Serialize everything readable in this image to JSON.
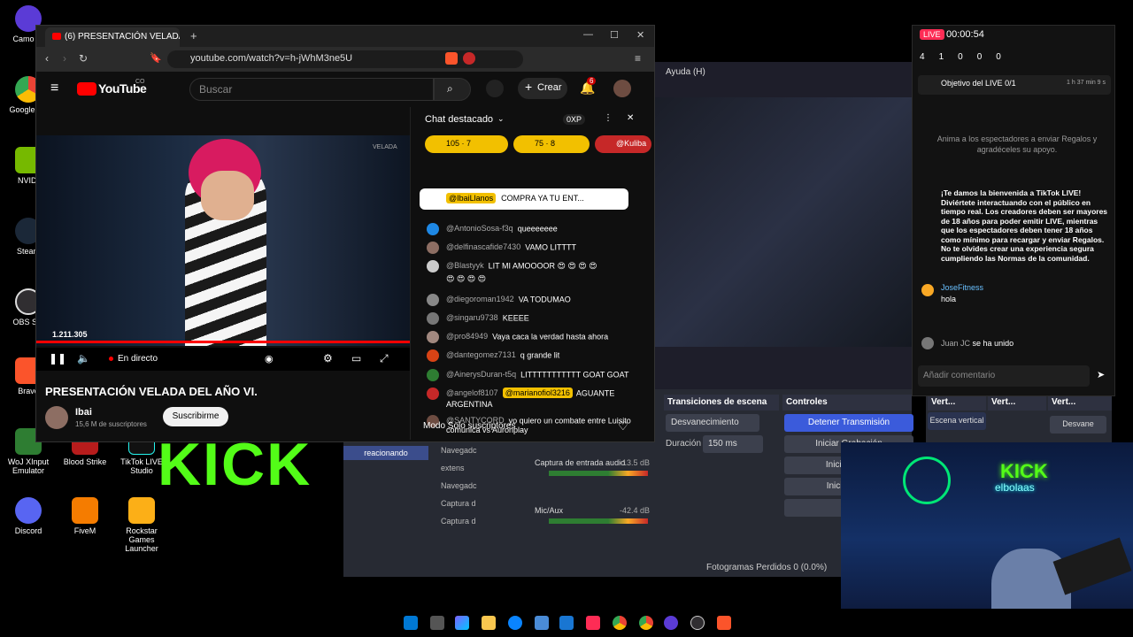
{
  "desktop": {
    "icons": [
      {
        "label": "Camo St",
        "color": "#5b3bd6"
      },
      {
        "label": "Google Ch",
        "color": "#2a8c3e"
      },
      {
        "label": "NVIDI",
        "color": "#76b900"
      },
      {
        "label": "Steam",
        "color": "#1b2838"
      },
      {
        "label": "OBS Stu",
        "color": "#302e31"
      },
      {
        "label": "Brave",
        "color": "#fb542b"
      },
      {
        "label": "WoJ XInput Emulator",
        "color": "#2e7d32"
      },
      {
        "label": "Blood Strike",
        "color": "#b71c1c"
      },
      {
        "label": "TikTok LIVE Studio",
        "color": "#111111"
      },
      {
        "label": "Discord",
        "color": "#5865f2"
      },
      {
        "label": "FiveM",
        "color": "#f57c00"
      },
      {
        "label": "Rockstar Games Launcher",
        "color": "#fcaf17"
      }
    ],
    "green_text": "KICK"
  },
  "browser": {
    "tab_title": "(6) PRESENTACIÓN VELADA D",
    "url": "youtube.com/watch?v=h-jWhM3ne5U",
    "window_controls": [
      "—",
      "☐",
      "✕"
    ]
  },
  "youtube": {
    "logo": "YouTube",
    "region": "CO",
    "search_placeholder": "Buscar",
    "create_label": "Crear",
    "notif_count": "6",
    "view_count": "1.211.305",
    "live_label": "En directo",
    "video_title": "PRESENTACIÓN VELADA DEL AÑO VI.",
    "channel_name": "Ibai",
    "subscribers": "15,6 M de suscriptores",
    "subscribe_label": "Suscribirme",
    "video_watermark": "VELADA"
  },
  "chat": {
    "title": "Chat destacado",
    "xp": "0XP",
    "pills": [
      {
        "likes": "105",
        "comments": "7"
      },
      {
        "likes": "75",
        "comments": "8"
      },
      {
        "name": "@Kuliba"
      }
    ],
    "pinned_author": "@IbaiLlanos",
    "pinned_text": "COMPRA YA TU ENT...",
    "messages": [
      {
        "author": "@AntonioSosa-f3q",
        "text": "queeeeeee",
        "color": "#1e88e5"
      },
      {
        "author": "@delfinascafide7430",
        "text": "VAMO LITTTT",
        "color": "#8d6e63"
      },
      {
        "author": "@Blastyyk",
        "text": "LIT MI AMOOOOR 😍 😍 😍 😍",
        "color": "#ccc"
      },
      {
        "author": "",
        "text": "😍 😍 😍 😍",
        "color": "transparent"
      },
      {
        "author": "@diegoroman1942",
        "text": "VA TODUMAO",
        "color": "#888"
      },
      {
        "author": "@singaru9738",
        "text": "KEEEE",
        "color": "#777"
      },
      {
        "author": "@pro84949",
        "text": "Vaya caca la verdad hasta ahora",
        "color": "#a1887f"
      },
      {
        "author": "@dantegomez7131",
        "text": "q grande lit",
        "color": "#d84315"
      },
      {
        "author": "@AinerysDuran-t5q",
        "text": "LITTTTTTTTTTT GOAT GOAT",
        "color": "#2e7d32"
      },
      {
        "author": "@angelof8107",
        "text": "AGUANTE",
        "color": "#c62828"
      },
      {
        "author": "",
        "text": "ARGENTINA",
        "color": "transparent"
      },
      {
        "author": "@SANTYCORD",
        "text": "yo quiero un combate entre Luisito",
        "color": "#6d4c41"
      },
      {
        "author": "",
        "text": "comunica vs Auronplay",
        "color": "transparent"
      }
    ],
    "mention": "@marianofiol3216",
    "subscribers_mode": "Modo Solo suscriptores"
  },
  "obs": {
    "menu": "Ayuda (H)",
    "transitions_title": "Transiciones de escena",
    "transition_type": "Desvanecimiento",
    "duration_label": "Duración",
    "duration_value": "150 ms",
    "controls_title": "Controles",
    "controls": [
      "Detener Transmisión",
      "Iniciar Grabación",
      "Iniciar el Bú",
      "Iniciar Cám",
      "Mo"
    ],
    "vertical_titles": [
      "Vert...",
      "Vert...",
      "Vert..."
    ],
    "vertical_scene": "Escena vertical",
    "vertical_transition": "Desvane",
    "audio_input": "Captura de entrada audio",
    "audio_input_db": "-13.5 dB",
    "mic": "Mic/Aux",
    "mic_db": "-42.4 dB",
    "sources": [
      "Navegadc",
      "extens",
      "Navegadc",
      "Captura d",
      "Captura d"
    ],
    "scene_item": "reacionando",
    "status": "Fotogramas Perdidos 0 (0.0%)"
  },
  "tiktok": {
    "live_badge": "LIVE",
    "timer": "00:00:54",
    "stats": [
      "4",
      "1",
      "0",
      "0",
      "0"
    ],
    "goal_title": "Objetivo del LIVE",
    "goal_progress": "0/1",
    "goal_time": "1 h 37 min 9 s",
    "hint": "Anima a los espectadores a enviar Regalos y agradéceles su apoyo.",
    "welcome": "¡Te damos la bienvenida a TikTok LIVE! Diviértete interactuando con el público en tiempo real. Los creadores deben ser mayores de 18 años para poder emitir LIVE, mientras que los espectadores deben tener 18 años como mínimo para recargar y enviar Regalos. No te olvides crear una experiencia segura cumpliendo las Normas de la comunidad.",
    "comment_user": "JoseFitness",
    "comment_text": "hola",
    "joined_user": "Juan JC",
    "joined_text": "se ha unido",
    "input_placeholder": "Añadir comentario"
  },
  "cam": {
    "neon_text": "KICK",
    "neon_sub": "elbolaas"
  }
}
